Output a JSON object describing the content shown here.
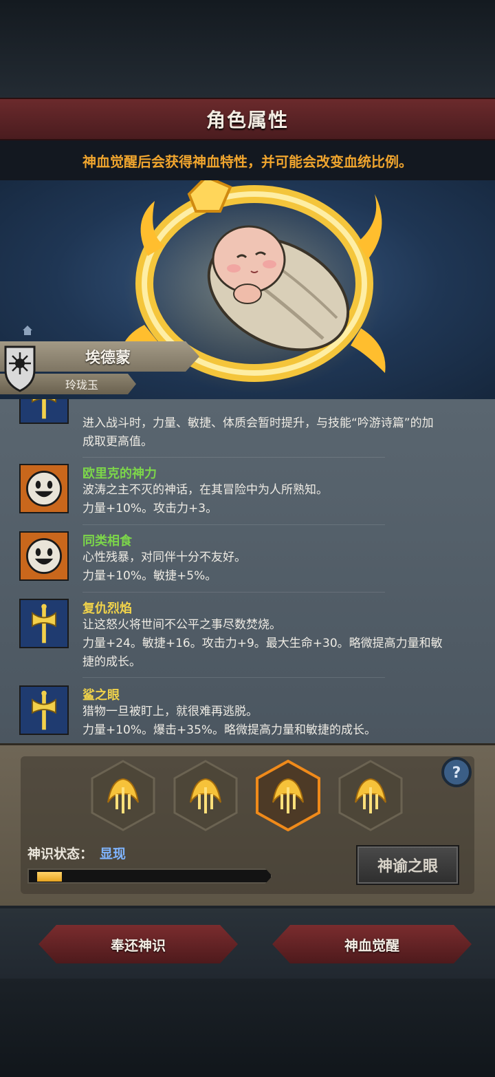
{
  "header": {
    "title": "角色属性"
  },
  "hint": "神血觉醒后会获得神血特性，并可能会改变血统比例。",
  "character": {
    "name": "埃德蒙",
    "subtitle": "玲珑玉"
  },
  "traits": [
    {
      "name": "",
      "desc1": "进入战斗时，力量、敏捷、体质会暂时提升，与技能“吟游诗篇”的加",
      "desc2": "成取更高值。",
      "icon": "axe-icon",
      "name_color": "#f0d24a"
    },
    {
      "name": "欧里克的神力",
      "desc1": "波涛之主不灭的神话，在其冒险中为人所熟知。",
      "desc2": "力量+10%。攻击力+3。",
      "icon": "smiley-face-icon",
      "name_color": "#7cd64a"
    },
    {
      "name": "同类相食",
      "desc1": "心性残暴，对同伴十分不友好。",
      "desc2": "力量+10%。敏捷+5%。",
      "icon": "smiley-face-icon",
      "name_color": "#7cd64a"
    },
    {
      "name": "复仇烈焰",
      "desc1": "让这怒火将世间不公平之事尽数焚烧。",
      "desc2": "力量+24。敏捷+16。攻击力+9。最大生命+30。略微提高力量和敏",
      "desc3": "捷的成长。",
      "icon": "axe-icon",
      "name_color": "#f0d24a"
    },
    {
      "name": "鲨之眼",
      "desc1": "猎物一旦被盯上，就很难再逃脱。",
      "desc2": "力量+10%。爆击+35%。略微提高力量和敏捷的成长。",
      "icon": "axe-icon",
      "name_color": "#f0d24a"
    }
  ],
  "divine": {
    "state_label": "神识状态：",
    "state_value": "显现",
    "progress": 0.11,
    "oracle_button": "神谕之眼",
    "selected_slot": 3
  },
  "buttons": {
    "return": "奉还神识",
    "awaken": "神血觉醒"
  },
  "colors": {
    "accent_orange": "#f0a52e",
    "title_red": "#5e2426",
    "state_blue": "#7fb4ff"
  }
}
